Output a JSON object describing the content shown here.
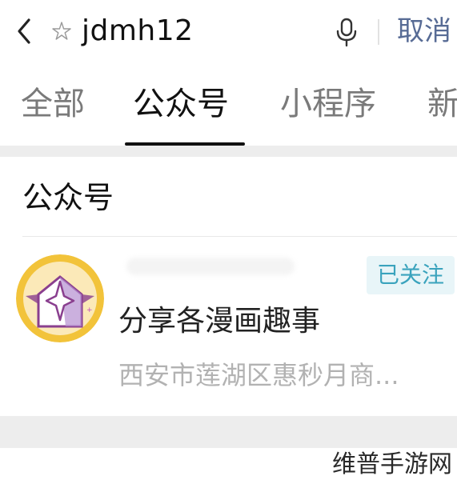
{
  "search": {
    "query": "jdmh12",
    "cancel_label": "取消"
  },
  "tabs": [
    {
      "label": "全部",
      "active": false
    },
    {
      "label": "公众号",
      "active": true
    },
    {
      "label": "小程序",
      "active": false
    },
    {
      "label": "新",
      "active": false
    }
  ],
  "results": {
    "section_title": "公众号",
    "account": {
      "status_badge": "已关注",
      "description": "分享各漫画趣事",
      "meta": "西安市莲湖区惠秒月商..."
    }
  },
  "watermark": "维普手游网",
  "colors": {
    "accent_link": "#576b95",
    "badge_text": "#3aa3bd",
    "badge_bg": "#e8f5f8",
    "avatar_gold": "#f2c33a",
    "avatar_purple": "#8a3f8f"
  },
  "icons": [
    "back-icon",
    "search-icon",
    "mic-icon"
  ]
}
